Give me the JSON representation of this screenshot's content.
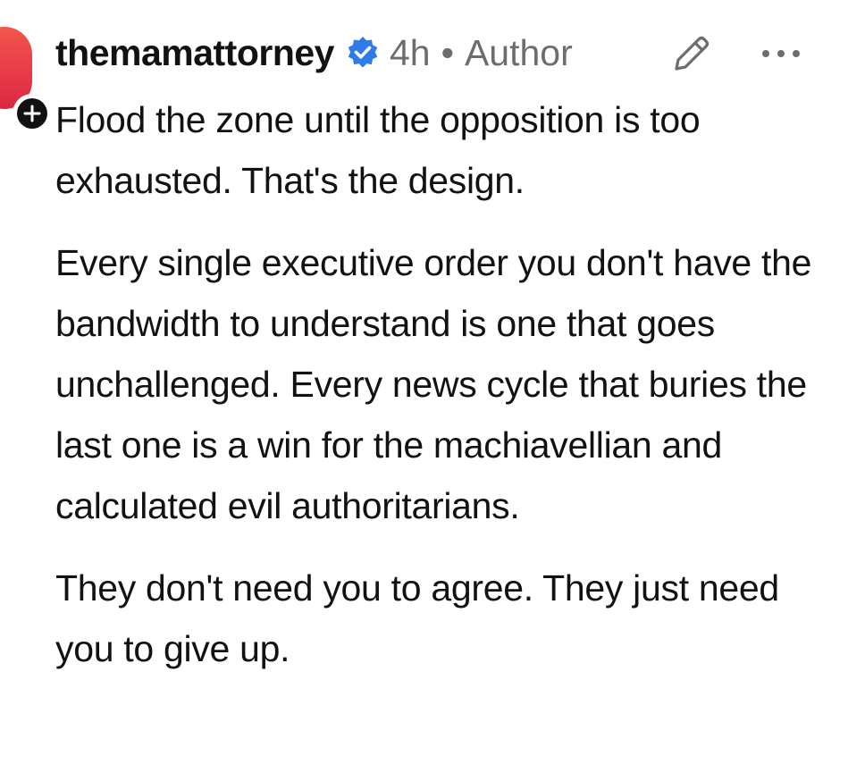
{
  "comment": {
    "username": "themamattorney",
    "time_ago": "4h",
    "separator": "•",
    "author_tag": "Author",
    "paragraphs": [
      "Flood the zone until the opposition is too exhausted. That's the design.",
      "Every single executive order you don't have the bandwidth to understand is one that goes unchallenged. Every news cycle that buries the last one is a win for the machiavellian and calculated evil authoritarians.",
      "They don't need you to agree. They just need you to give up."
    ]
  },
  "icons": {
    "verified": "verified-badge-icon",
    "edit": "pencil-icon",
    "more": "more-options-icon",
    "follow": "plus-icon"
  },
  "colors": {
    "verified_blue": "#2f7bea",
    "avatar_red": "#e8394a",
    "meta_gray": "#6d6d6d",
    "text": "#121212"
  }
}
